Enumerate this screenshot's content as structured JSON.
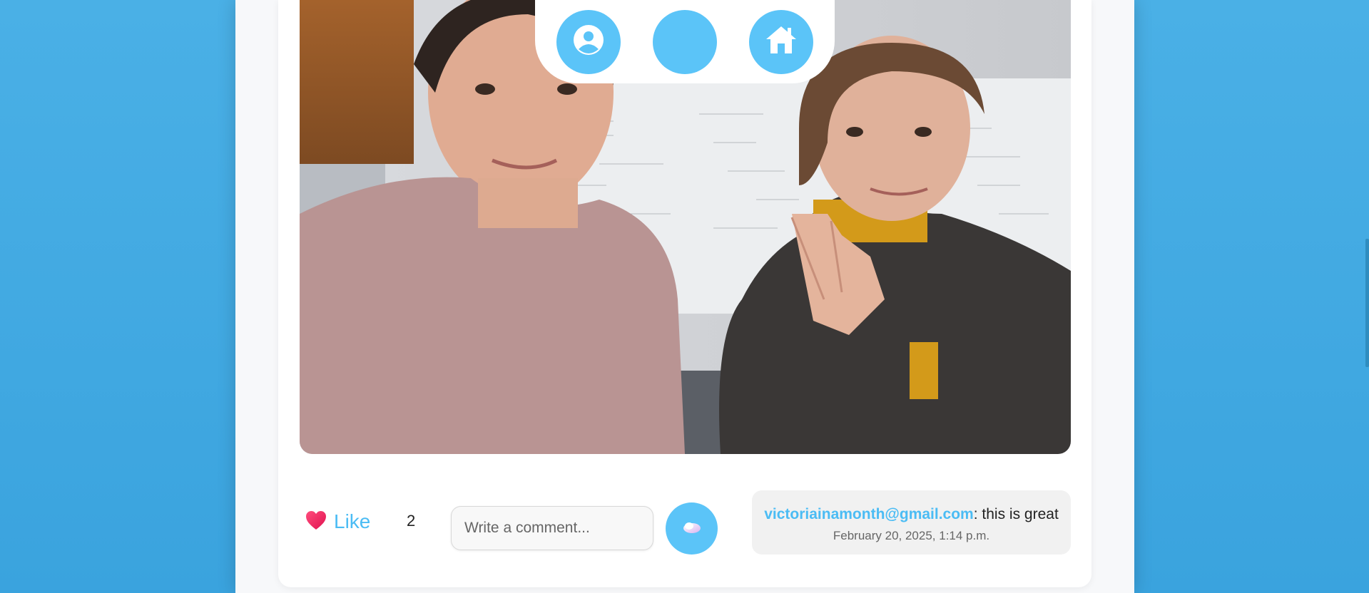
{
  "theme": {
    "accent": "#5bc4f8",
    "link": "#4bbcf4",
    "background": "#4ab0e6"
  },
  "nav": {
    "items": [
      {
        "icon": "user-circle-icon"
      },
      {
        "icon": "blank"
      },
      {
        "icon": "home-icon"
      }
    ]
  },
  "post": {
    "image_icon": "photo-image",
    "like_label": "Like",
    "like_count": "2",
    "comment_placeholder": "Write a comment...",
    "comment_value": "",
    "send_icon": "cloud-icon"
  },
  "comments": [
    {
      "author": "victoriainamonth@gmail.com",
      "separator": ":",
      "text": " this is great",
      "timestamp": "February 20, 2025, 1:14 p.m."
    }
  ]
}
